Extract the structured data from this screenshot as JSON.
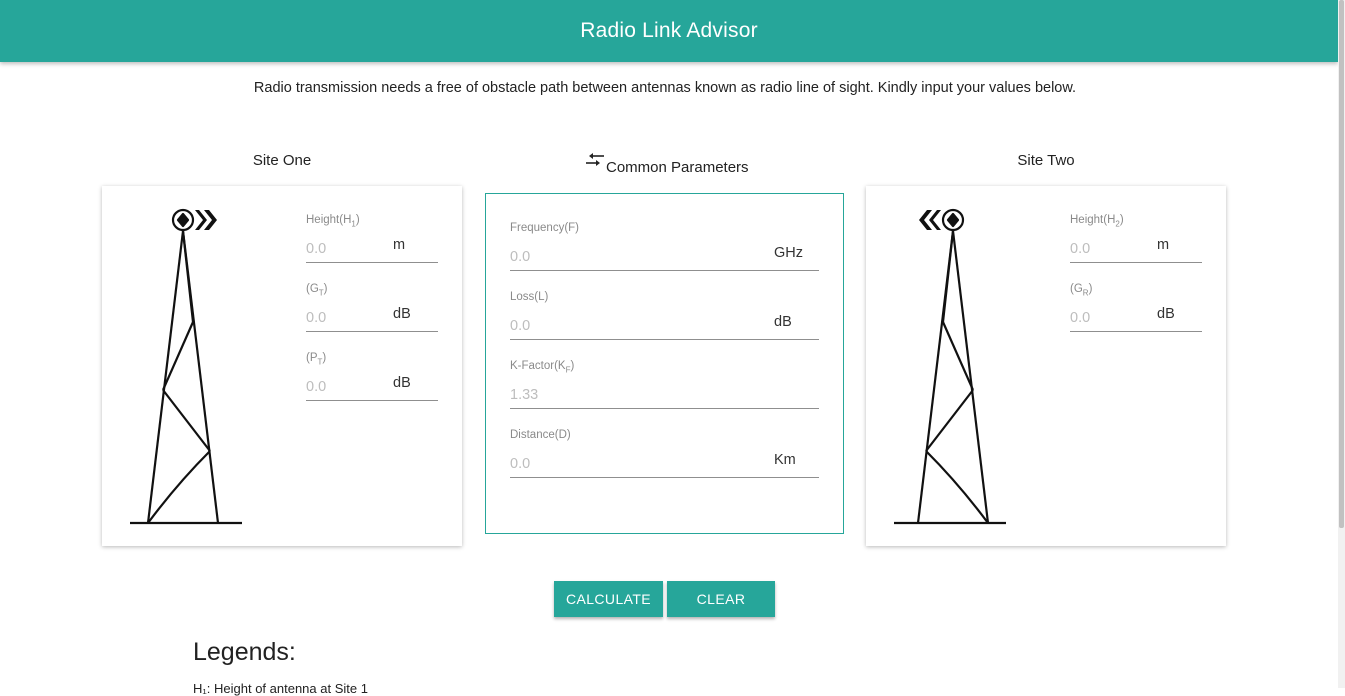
{
  "app": {
    "title": "Radio Link Advisor"
  },
  "intro": "Radio transmission needs a free of obstacle path between antennas known as radio line of sight. Kindly input your values below.",
  "site_one": {
    "title": "Site One",
    "fields": [
      {
        "label_main": "Height(H",
        "label_sub": "1",
        "label_end": ")",
        "placeholder": "0.0",
        "unit": "m"
      },
      {
        "label_main": "(G",
        "label_sub": "T",
        "label_end": ")",
        "placeholder": "0.0",
        "unit": "dB"
      },
      {
        "label_main": "(P",
        "label_sub": "T",
        "label_end": ")",
        "placeholder": "0.0",
        "unit": "dB"
      }
    ]
  },
  "common": {
    "title": "Common Parameters",
    "icon": "swap-arrows-icon",
    "fields": [
      {
        "label_main": "Frequency(F)",
        "label_sub": "",
        "label_end": "",
        "placeholder": "0.0",
        "unit": "GHz"
      },
      {
        "label_main": "Loss(L)",
        "label_sub": "",
        "label_end": "",
        "placeholder": "0.0",
        "unit": "dB"
      },
      {
        "label_main": "K-Factor(K",
        "label_sub": "F",
        "label_end": ")",
        "placeholder": "1.33",
        "unit": ""
      },
      {
        "label_main": "Distance(D)",
        "label_sub": "",
        "label_end": "",
        "placeholder": "0.0",
        "unit": "Km"
      }
    ]
  },
  "site_two": {
    "title": "Site Two",
    "fields": [
      {
        "label_main": "Height(H",
        "label_sub": "2",
        "label_end": ")",
        "placeholder": "0.0",
        "unit": "m"
      },
      {
        "label_main": "(G",
        "label_sub": "R",
        "label_end": ")",
        "placeholder": "0.0",
        "unit": "dB"
      }
    ]
  },
  "buttons": {
    "calculate": "CALCULATE",
    "clear": "CLEAR"
  },
  "legends": {
    "title": "Legends:",
    "first_line": "H₁: Height of antenna at Site 1"
  },
  "colors": {
    "primary": "#26a69a",
    "placeholder": "#bdbdbd",
    "underline": "#8f8f8f"
  }
}
